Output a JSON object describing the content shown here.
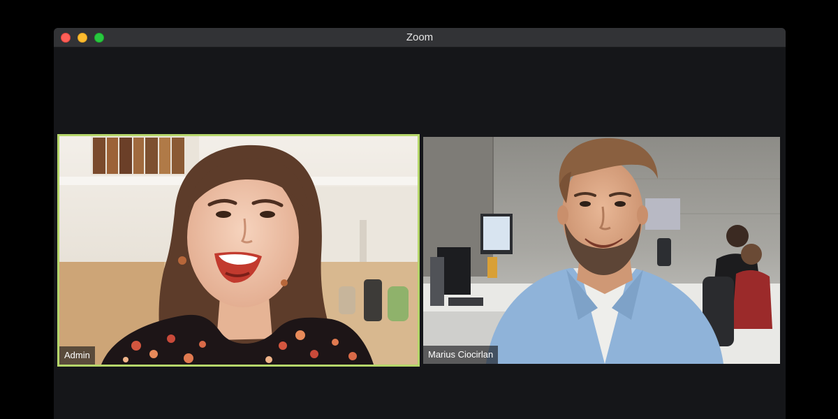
{
  "window": {
    "title": "Zoom"
  },
  "participants": [
    {
      "name": "Admin",
      "active_speaker": true,
      "video_content": "woman-laughing-in-kitchen"
    },
    {
      "name": "Marius Ciocirlan",
      "active_speaker": false,
      "video_content": "man-smiling-in-office"
    }
  ],
  "colors": {
    "active_speaker_border": "#b5d66a",
    "window_background": "#151619",
    "titlebar_background": "#323336",
    "close_button": "#fe5f57",
    "minimize_button": "#febc2e",
    "maximize_button": "#28c840"
  }
}
